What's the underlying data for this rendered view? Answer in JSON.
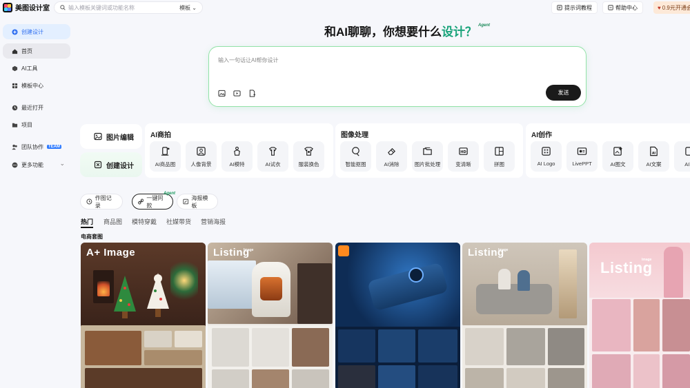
{
  "app": {
    "title": "美图设计室"
  },
  "search": {
    "placeholder": "输入模板关键词或功能名称",
    "scope": "模板"
  },
  "topbar": {
    "tutorial": "提示词教程",
    "help": "帮助中心",
    "vip": "0.9元开通会"
  },
  "sidebar": {
    "create": "创建设计",
    "items": [
      {
        "label": "首页",
        "icon": "home-icon"
      },
      {
        "label": "AI工具",
        "icon": "ai-cube-icon"
      },
      {
        "label": "模板中心",
        "icon": "template-grid-icon"
      },
      {
        "label": "最近打开",
        "icon": "clock-icon"
      },
      {
        "label": "项目",
        "icon": "folder-icon"
      },
      {
        "label": "团队协作",
        "icon": "team-icon",
        "badge": "TEAM"
      },
      {
        "label": "更多功能",
        "icon": "more-icon"
      }
    ]
  },
  "hero": {
    "headline_pre": "和AI聊聊，你想要什么",
    "headline_accent": "设计？",
    "agent": "Agent"
  },
  "prompt": {
    "placeholder": "输入一句话让AI帮你设计",
    "send": "发送"
  },
  "quick": {
    "edit": "图片编辑",
    "create": "创建设计"
  },
  "panels": {
    "commerce": {
      "title": "AI商拍",
      "tools": [
        "AI商品图",
        "人像背景",
        "AI模特",
        "AI试衣",
        "服装换色"
      ]
    },
    "image": {
      "title": "图像处理",
      "tools": [
        "智能抠图",
        "AI消除",
        "图片批处理",
        "变清晰",
        "拼图"
      ]
    },
    "create": {
      "title": "AI创作",
      "tools": [
        "AI Logo",
        "LivePPT",
        "AI图文",
        "AI文案",
        "AI商"
      ]
    }
  },
  "pills": {
    "history": "作图记录",
    "same": "一键同款",
    "poster": "海报模板",
    "agent": "Agent"
  },
  "subtabs": [
    "热门",
    "商品图",
    "模特穿戴",
    "社媒带货",
    "营销海报"
  ],
  "section": {
    "title": "电商套图"
  },
  "cards": [
    {
      "title": "A+ Image",
      "sub": ""
    },
    {
      "title": "Listing",
      "sub": "Image"
    },
    {
      "title": "",
      "sub": ""
    },
    {
      "title": "Listing",
      "sub": "Image"
    },
    {
      "title": "Listing",
      "sub": "Image"
    }
  ],
  "colors": {
    "accent_blue": "#2f6ff0",
    "accent_green": "#19a37a",
    "send_bg": "#1a1a1a"
  }
}
